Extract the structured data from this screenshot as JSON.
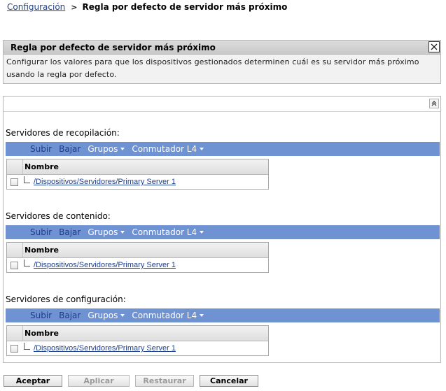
{
  "breadcrumb": {
    "parent": "Configuración",
    "separator": ">",
    "current": "Regla por defecto de servidor más próximo"
  },
  "info": {
    "title": "Regla por defecto de servidor más próximo",
    "description": "Configurar los valores para que los dispositivos gestionados determinen cuál es su servidor más próximo usando la regla por defecto."
  },
  "toolbar": {
    "up": "Subir",
    "down": "Bajar",
    "groups": "Grupos",
    "l4switch": "Conmutador L4"
  },
  "table": {
    "name_header": "Nombre"
  },
  "sections": [
    {
      "label": "Servidores de recopilación:",
      "rows": [
        "/Dispositivos/Servidores/Primary Server 1"
      ]
    },
    {
      "label": "Servidores de contenido:",
      "rows": [
        "/Dispositivos/Servidores/Primary Server 1"
      ]
    },
    {
      "label": "Servidores de configuración:",
      "rows": [
        "/Dispositivos/Servidores/Primary Server 1"
      ]
    }
  ],
  "buttons": {
    "accept": "Aceptar",
    "apply": "Aplicar",
    "restore": "Restaurar",
    "cancel": "Cancelar"
  },
  "colors": {
    "toolbar_bg": "#6f93d2",
    "link": "#1f3f8f"
  }
}
